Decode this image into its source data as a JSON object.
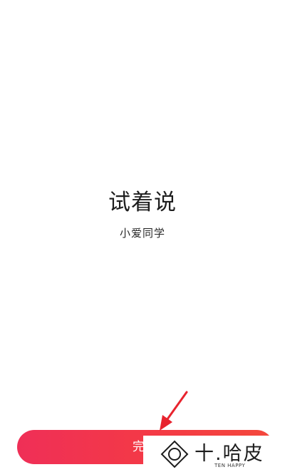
{
  "content": {
    "heading": "试着说",
    "wake_word": "小爱同学"
  },
  "footer": {
    "done_label": "完成",
    "button_gradient": [
      "#ef2f57",
      "#f4483c"
    ]
  },
  "annotation": {
    "arrow_color": "#e8232e",
    "arrow_icon": "red-arrow-icon"
  },
  "watermark": {
    "title": "十.哈皮",
    "subtitle": "TEN HAPPY",
    "logo_icon": "diamond-circle-logo-icon"
  }
}
